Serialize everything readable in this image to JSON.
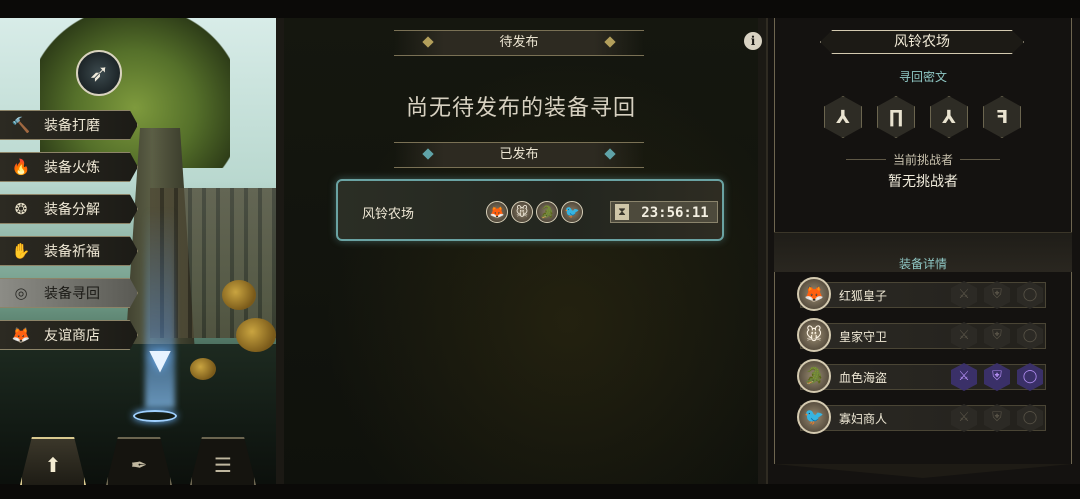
{
  "sidebar": {
    "emblem_icon": "winged-arrow-emblem",
    "items": [
      {
        "label": "装备打磨",
        "icon": "hammer-icon",
        "glyph": "🔨",
        "active": false
      },
      {
        "label": "装备火炼",
        "icon": "flame-icon",
        "glyph": "🔥",
        "active": false
      },
      {
        "label": "装备分解",
        "icon": "swirl-icon",
        "glyph": "❂",
        "active": false
      },
      {
        "label": "装备祈福",
        "icon": "praying-hands-icon",
        "glyph": "✋",
        "active": false
      },
      {
        "label": "装备寻回",
        "icon": "spiral-icon",
        "glyph": "◎",
        "active": true
      },
      {
        "label": "友谊商店",
        "icon": "fox-head-icon",
        "glyph": "🦊",
        "active": false
      }
    ]
  },
  "bottom_nav": [
    {
      "icon": "upload-arrow-icon",
      "glyph": "⬆",
      "active": true
    },
    {
      "icon": "feather-icon",
      "glyph": "✒",
      "active": false
    },
    {
      "icon": "list-icon",
      "glyph": "☰",
      "active": false
    }
  ],
  "center": {
    "pending_section": "待发布",
    "pending_empty_text": "尚无待发布的装备寻回",
    "published_section": "已发布",
    "published_card": {
      "title": "风铃农场",
      "avatars": [
        {
          "icon": "red-fox-prince-avatar",
          "glyph": "🦊"
        },
        {
          "icon": "royal-guard-avatar",
          "glyph": "🐭"
        },
        {
          "icon": "crimson-pirate-avatar",
          "glyph": "🐊"
        },
        {
          "icon": "widow-merchant-avatar",
          "glyph": "🐦"
        }
      ],
      "timer": "23:56:11"
    }
  },
  "right": {
    "map_name": "风铃农场",
    "runes_header": "寻回密文",
    "runes": [
      "⅄",
      "∏",
      "⅄",
      "ꟻ"
    ],
    "challenger_label": "当前挑战者",
    "challenger_value": "暂无挑战者",
    "equipment_header": "装备详情",
    "equipment": [
      {
        "name": "红狐皇子",
        "avatar_icon": "red-fox-prince-avatar",
        "glyph": "🦊",
        "slots": [
          false,
          false,
          false
        ]
      },
      {
        "name": "皇家守卫",
        "avatar_icon": "royal-guard-avatar",
        "glyph": "🐭",
        "slots": [
          false,
          false,
          false
        ]
      },
      {
        "name": "血色海盗",
        "avatar_icon": "crimson-pirate-avatar",
        "glyph": "🐊",
        "slots": [
          true,
          true,
          true
        ]
      },
      {
        "name": "寡妇商人",
        "avatar_icon": "widow-merchant-avatar",
        "glyph": "🐦",
        "slots": [
          false,
          false,
          false
        ]
      }
    ]
  },
  "colors": {
    "accent_teal": "#6aa3a3",
    "owned_slot": "#3a3068",
    "menu_active": "#8c8c86"
  }
}
